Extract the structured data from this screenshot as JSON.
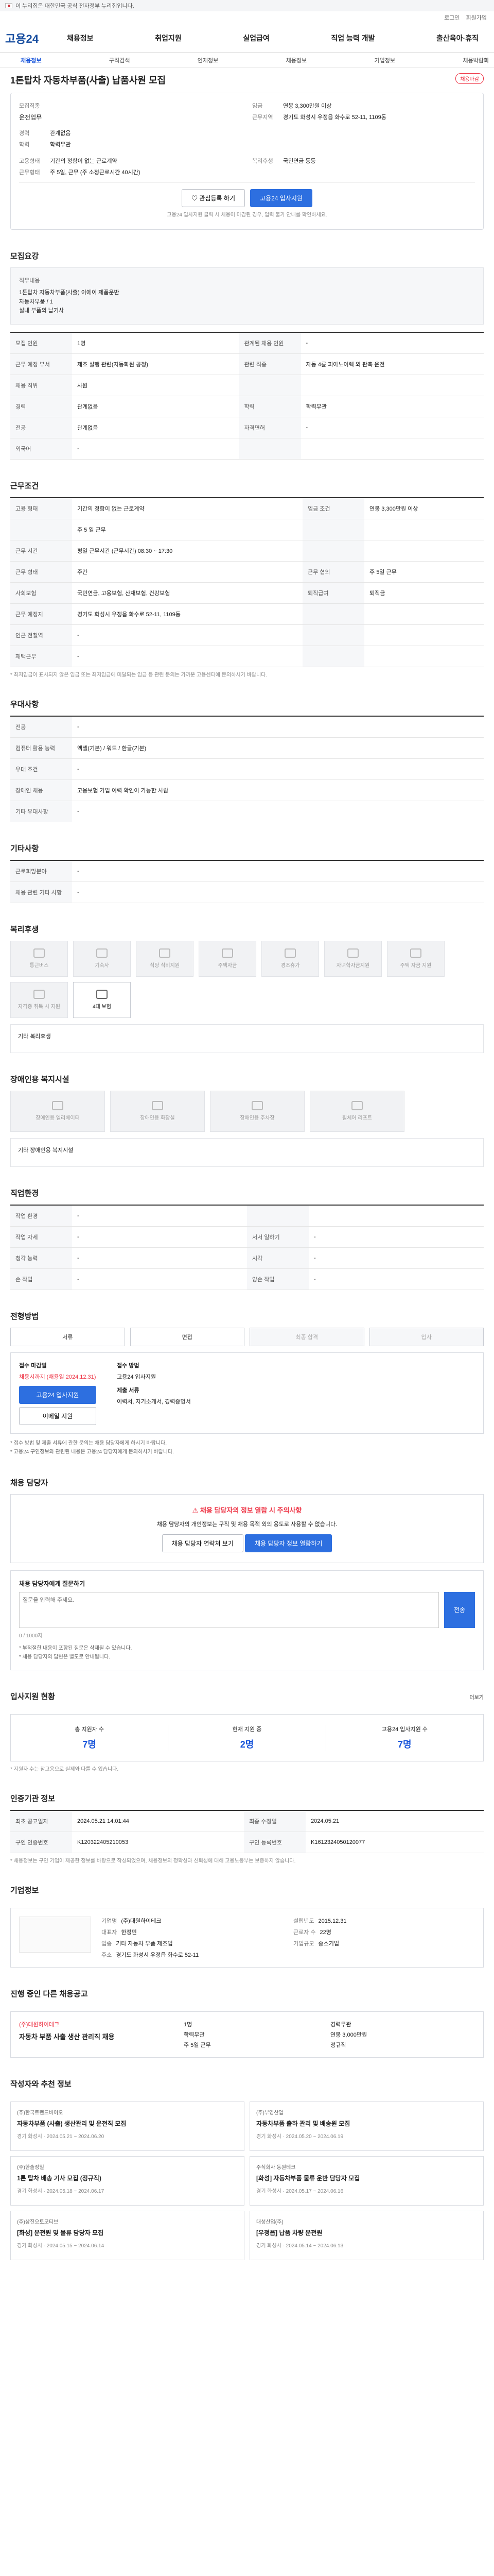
{
  "gov_bar": "이 누리집은 대한민국 공식 전자정부 누리집입니다.",
  "top_links": [
    "로그인",
    "회원가입"
  ],
  "logo": "고용24",
  "gnb": [
    "채용정보",
    "취업지원",
    "실업급여",
    "직업 능력 개발",
    "출산육아·휴직"
  ],
  "subnav": [
    "채용정보",
    "구직검색",
    "인재정보",
    "채용정보",
    "기업정보",
    "채용박람회"
  ],
  "job": {
    "title": "1톤탑차 자동차부품(사출) 납품사원 모집",
    "status": "채용마감",
    "company_label": "모집직종",
    "company": "운전업무",
    "career_label": "경력",
    "career": "관계없음",
    "edu_label": "학력",
    "edu": "학력무관",
    "salary_label": "임금",
    "salary": "연봉 3,300만원 이상",
    "location_label": "근무지역",
    "location": "경기도 화성시 우정읍 화수로 52-11, 1109동",
    "emp_label": "고용형태",
    "emp": "기간의 정함이 없는 근로계약",
    "work_label": "근무형태",
    "work": "주 5일, 근무 (주 소정근로시간 40시간)",
    "reg_label": "복리후생",
    "reg": "국민연금 등등"
  },
  "buttons": {
    "scrap": "관심등록 하기",
    "apply": "고용24 입사지원"
  },
  "notice_top": "고용24 입사지원 클릭 시 채용이 마감된 경우, 입력 불가 안내를 확인하세요.",
  "sections": {
    "recruit": "모집요강",
    "conditions": "근무조건",
    "benefits": "우대사항",
    "others": "기타사항",
    "welfare": "복리후생",
    "disability": "장애인용 복지시설",
    "reception": "직업환경",
    "process": "전형방법",
    "contact": "채용 담당자",
    "stats": "입사지원 현황",
    "schedule": "인증기관 정보",
    "company": "기업정보",
    "recent": "진행 중인 다른 채용공고",
    "recommend": "작성자와 추천 정보"
  },
  "recruit_box": {
    "title": "직무내용",
    "desc": "1톤탑차 자동차부품(사출) 이에이 제품운반\n자동차부품 / 1\n실내 부품의 납기사"
  },
  "recruit_rows": [
    [
      "모집 인원",
      "1명",
      "관계된 채용 인원",
      "-"
    ],
    [
      "근무 예정 부서",
      "제조 실행 관련(자동화된 공정)",
      "관련 직종",
      "자동 4륜 피아노이렉 외 판촉 운전"
    ],
    [
      "채용 직위",
      "사원",
      "",
      ""
    ],
    [
      "경력",
      "관계없음",
      "학력",
      "학력무관"
    ],
    [
      "전공",
      "관계없음",
      "자격면허",
      "-"
    ],
    [
      "외국어",
      "-",
      "",
      ""
    ]
  ],
  "cond_rows": [
    [
      "고용 형태",
      "기간의 정함이 없는 근로계약",
      "임금 조건",
      "연봉 3,300만원 이상"
    ],
    [
      "",
      "주 5 일 근무",
      "",
      ""
    ],
    [
      "근무 시간",
      "평일 근무시간 (근무시간) 08:30 ~ 17:30",
      "",
      ""
    ],
    [
      "근무 형태",
      "주간",
      "근무 협의",
      "주 5일 근무"
    ],
    [
      "사회보험",
      "국민연금, 고용보험, 산재보험, 건강보험",
      "퇴직급여",
      "퇴직금"
    ],
    [
      "근무 예정지",
      "경기도 화성시 우정읍 화수로 52-11, 1109동",
      "",
      ""
    ],
    [
      "인근 전철역",
      "-",
      "",
      ""
    ],
    [
      "재택근무",
      "-",
      "",
      ""
    ]
  ],
  "cond_note": "* 최저임금이 표시되지 않은 임금 또는 최저임금에 미달되는 임금 등 관련 문의는 가까운 고용센터에 문의하시기 바랍니다.",
  "benefit_rows": [
    [
      "전공",
      "-"
    ],
    [
      "컴퓨터 활용 능력",
      "엑셀(기본) / 워드 / 한글(기본)"
    ],
    [
      "우대 조건",
      "-"
    ],
    [
      "장애인 채용",
      "고용보험 가입 이력 확인이 가능한 사람"
    ],
    [
      "기타 우대사항",
      "-"
    ]
  ],
  "other_rows": [
    [
      "근로희망분야",
      "-"
    ],
    [
      "채용 관련 기타 사항",
      "-"
    ]
  ],
  "welfare_tiles": [
    "통근버스",
    "기숙사",
    "식당 식비지원",
    "주택자금",
    "경조휴가",
    "자녀학자금지원",
    "주택 자금 지원",
    "자격증 취득 시 지원",
    "4대 보험"
  ],
  "welfare_text": "기타 복리후생",
  "disability_tiles": [
    "장애인용 엘리베이터",
    "장애인용 화장실",
    "장애인용 주차장",
    "휠체어 리프트"
  ],
  "disability_text": "기타 장애인용 복지시설",
  "env_rows": [
    [
      "작업 환경",
      "-",
      "",
      ""
    ],
    [
      "작업 자세",
      "-",
      "서서 일하기",
      "-"
    ],
    [
      "청각 능력",
      "-",
      "시각",
      "-"
    ],
    [
      "손 작업",
      "-",
      "양손 작업",
      "-"
    ]
  ],
  "process_steps": [
    "서류",
    "면접",
    "최종 합격",
    "입사"
  ],
  "apply": {
    "deadline_label": "접수 마감일",
    "deadline": "채용시까지 (채용일 2024.12.31)",
    "method_label": "접수 방법",
    "method": "고용24 입사지원",
    "doc_label": "제출 서류",
    "doc": "이력서, 자기소개서, 경력증명서"
  },
  "apply_buttons": [
    "고용24 입사지원",
    "이메일 지원"
  ],
  "apply_bullets": [
    "* 접수 방법 및 제출 서류에 관한 문의는 채용 담당자에게 하시기 바랍니다.",
    "* 고용24 구인정보와 관련된 내용은 고용24 담당자에게 문의하시기 바랍니다."
  ],
  "contact": {
    "alert": "채용 담당자의 정보 열람 시 주의사항",
    "text": "채용 담당자의 개인정보는 구직 및 채용 목적 외의 용도로 사용할 수 없습니다.",
    "buttons": [
      "채용 담당자 연락처 보기",
      "채용 담당자 정보 열람하기"
    ]
  },
  "qa": {
    "title": "채용 담당자에게 질문하기",
    "placeholder": "질문을 입력해 주세요.",
    "submit": "전송",
    "count": "0 / 1000자",
    "notes": [
      "* 부적절한 내용이 포함된 질문은 삭제될 수 있습니다.",
      "* 채용 담당자의 답변은 별도로 안내됩니다."
    ]
  },
  "stats": [
    {
      "label": "총 지원자 수",
      "value": "7명"
    },
    {
      "label": "현재 지원 중",
      "value": "2명"
    },
    {
      "label": "고용24 입사지원 수",
      "value": "7명"
    }
  ],
  "stats_note": "* 지원자 수는 참고용으로 실제와 다를 수 있습니다.",
  "schedule_rows": [
    [
      "최초 공고일자",
      "2024.05.21 14:01:44",
      "최종 수정일",
      "2024.05.21"
    ],
    [
      "구인 인증번호",
      "K120322405210053",
      "구인 등록번호",
      "K1612324050120077"
    ]
  ],
  "schedule_note": "* 채용정보는 구인 기업이 제공한 정보를 바탕으로 작성되었으며, 채용정보의 정확성과 신뢰성에 대해 고용노동부는 보증하지 않습니다.",
  "company": {
    "name_label": "기업명",
    "name": "(주)대원하이테크",
    "rep_label": "대표자",
    "rep": "한정민",
    "biz_label": "업종",
    "biz": "기타 자동차 부품 제조업",
    "size_label": "기업규모",
    "size": "중소기업",
    "staff_label": "근로자 수",
    "staff": "22명",
    "found_label": "설립년도",
    "found": "2015.12.31",
    "addr_label": "주소",
    "addr": "경기도 화성시 우정읍 화수로 52-11"
  },
  "ad": {
    "name": "(주)대원하이테크",
    "title": "자동차 부품 사출 생산 관리직 채용",
    "items": [
      "1명",
      "경력무관",
      "학력무관",
      "연봉 3,000만원",
      "주 5일 근무",
      "정규직"
    ]
  },
  "recommend": [
    {
      "co": "(주)한국트랜드바이오",
      "title": "자동차부품 (사출) 생산관리 및 운전직 모집",
      "meta": "경기 화성시 · 2024.05.21 ~ 2024.06.20"
    },
    {
      "co": "(주)부영산업",
      "title": "자동차부품 출하 관리 및 배송원 모집",
      "meta": "경기 화성시 · 2024.05.20 ~ 2024.06.19"
    },
    {
      "co": "(주)한솔정밀",
      "title": "1톤 탑차 배송 기사 모집 (정규직)",
      "meta": "경기 화성시 · 2024.05.18 ~ 2024.06.17"
    },
    {
      "co": "주식회사 동원테크",
      "title": "[화성] 자동차부품 물류 운반 담당자 모집",
      "meta": "경기 화성시 · 2024.05.17 ~ 2024.06.16"
    },
    {
      "co": "(주)삼진오토모티브",
      "title": "[화성] 운전원 및 물류 담당자 모집",
      "meta": "경기 화성시 · 2024.05.15 ~ 2024.06.14"
    },
    {
      "co": "대성산업(주)",
      "title": "[우정읍] 납품 차량 운전원",
      "meta": "경기 화성시 · 2024.05.14 ~ 2024.06.13"
    }
  ],
  "more": "더보기"
}
